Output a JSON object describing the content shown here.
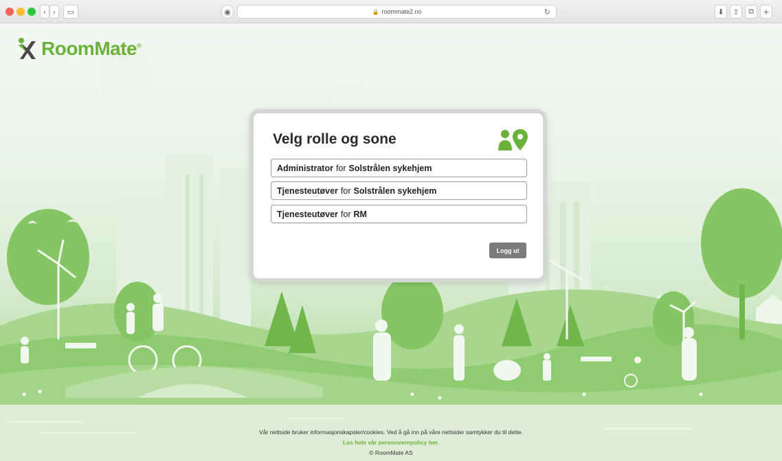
{
  "browser": {
    "url": "roommate2.no"
  },
  "brand": {
    "name": "RoomMate",
    "registered": "®",
    "color": "#6bb23b"
  },
  "modal": {
    "title": "Velg rolle og sone",
    "icon": "user-location-icon",
    "roles": [
      {
        "role": "Administrator",
        "joiner": "for",
        "zone": "Solstrålen sykehjem"
      },
      {
        "role": "Tjenesteutøver",
        "joiner": "for",
        "zone": "Solstrålen sykehjem"
      },
      {
        "role": "Tjenesteutøver",
        "joiner": "for",
        "zone": "RM"
      }
    ],
    "logout_label": "Logg ut"
  },
  "footer": {
    "cookie_text": "Vår nettside bruker informasjonskapsler/cookies. Ved å gå inn på våre nettsider samtykker du til dette.",
    "policy_link": "Les hele vår personvernpolicy her.",
    "copyright": "© RoomMate AS"
  }
}
